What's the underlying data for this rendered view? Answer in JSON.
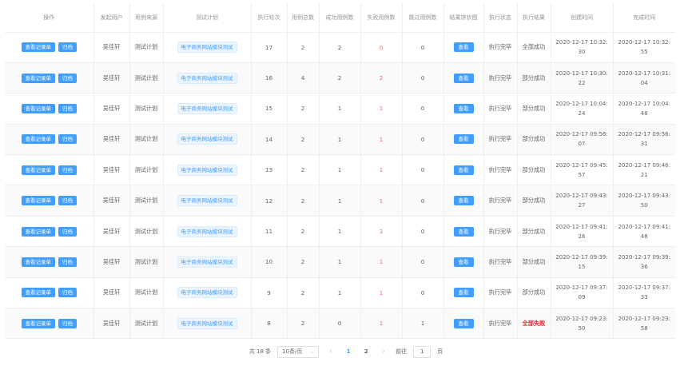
{
  "table": {
    "headers": [
      "操作",
      "发起用户",
      "用例来源",
      "测试计划",
      "执行轮次",
      "用例总数",
      "成功用例数",
      "失败用例数",
      "跳过用例数",
      "结果饼状图",
      "执行状态",
      "执行结果",
      "创建时间",
      "完成时间"
    ],
    "view_record_label": "查看记录单",
    "archive_label": "归档",
    "pie_view_label": "查看",
    "rows": [
      {
        "user": "吴佳轩",
        "source": "测试计划",
        "plan": "电子商务网站模块测试",
        "round": "17",
        "total": "2",
        "success": "2",
        "failed": "0",
        "skipped": "0",
        "status": "执行完毕",
        "result": "全部成功",
        "created": "2020-12-17 10:32:30",
        "finished": "2020-12-17 10:32:55"
      },
      {
        "user": "吴佳轩",
        "source": "测试计划",
        "plan": "电子商务网站模块测试",
        "round": "16",
        "total": "4",
        "success": "2",
        "failed": "2",
        "skipped": "0",
        "status": "执行完毕",
        "result": "部分成功",
        "created": "2020-12-17 10:30:22",
        "finished": "2020-12-17 10:31:04"
      },
      {
        "user": "吴佳轩",
        "source": "测试计划",
        "plan": "电子商务网站模块测试",
        "round": "15",
        "total": "2",
        "success": "1",
        "failed": "1",
        "skipped": "0",
        "status": "执行完毕",
        "result": "部分成功",
        "created": "2020-12-17 10:04:24",
        "finished": "2020-12-17 10:04:48"
      },
      {
        "user": "吴佳轩",
        "source": "测试计划",
        "plan": "电子商务网站模块测试",
        "round": "14",
        "total": "2",
        "success": "1",
        "failed": "1",
        "skipped": "0",
        "status": "执行完毕",
        "result": "部分成功",
        "created": "2020-12-17 09:56:07",
        "finished": "2020-12-17 09:56:31"
      },
      {
        "user": "吴佳轩",
        "source": "测试计划",
        "plan": "电子商务网站模块测试",
        "round": "13",
        "total": "2",
        "success": "1",
        "failed": "1",
        "skipped": "0",
        "status": "执行完毕",
        "result": "部分成功",
        "created": "2020-12-17 09:45:57",
        "finished": "2020-12-17 09:46:21"
      },
      {
        "user": "吴佳轩",
        "source": "测试计划",
        "plan": "电子商务网站模块测试",
        "round": "12",
        "total": "2",
        "success": "1",
        "failed": "1",
        "skipped": "0",
        "status": "执行完毕",
        "result": "部分成功",
        "created": "2020-12-17 09:43:27",
        "finished": "2020-12-17 09:43:50"
      },
      {
        "user": "吴佳轩",
        "source": "测试计划",
        "plan": "电子商务网站模块测试",
        "round": "11",
        "total": "2",
        "success": "1",
        "failed": "1",
        "skipped": "0",
        "status": "执行完毕",
        "result": "部分成功",
        "created": "2020-12-17 09:41:26",
        "finished": "2020-12-17 09:41:48"
      },
      {
        "user": "吴佳轩",
        "source": "测试计划",
        "plan": "电子商务网站模块测试",
        "round": "10",
        "total": "2",
        "success": "1",
        "failed": "1",
        "skipped": "0",
        "status": "执行完毕",
        "result": "部分成功",
        "created": "2020-12-17 09:39:15",
        "finished": "2020-12-17 09:39:36"
      },
      {
        "user": "吴佳轩",
        "source": "测试计划",
        "plan": "电子商务网站模块测试",
        "round": "9",
        "total": "2",
        "success": "1",
        "failed": "1",
        "skipped": "0",
        "status": "执行完毕",
        "result": "部分成功",
        "created": "2020-12-17 09:37:09",
        "finished": "2020-12-17 09:37:33"
      },
      {
        "user": "吴佳轩",
        "source": "测试计划",
        "plan": "电子商务网站模块测试",
        "round": "8",
        "total": "2",
        "success": "0",
        "failed": "1",
        "skipped": "1",
        "status": "执行完毕",
        "result": "全部失败",
        "created": "2020-12-17 09:23:50",
        "finished": "2020-12-17 09:23:58"
      }
    ]
  },
  "pagination": {
    "total_label": "共 18 条",
    "page_size_label": "10条/页",
    "pages": [
      "1",
      "2"
    ],
    "current_page": "1",
    "goto_prefix": "前往",
    "goto_value": "1",
    "goto_suffix": "页"
  },
  "colors": {
    "primary": "#409eff",
    "danger": "#f56c6c",
    "failed_result": "#f5222d"
  }
}
